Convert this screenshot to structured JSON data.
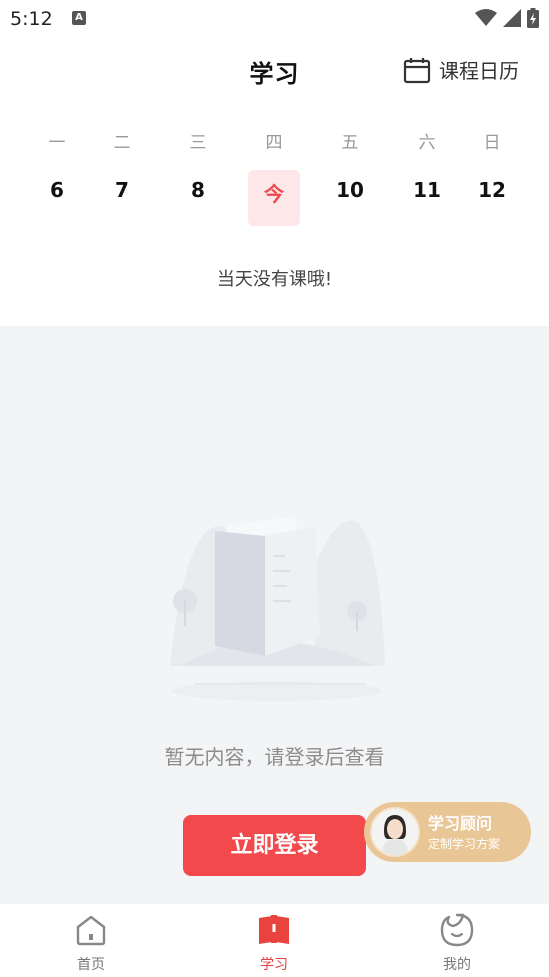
{
  "status_bar": {
    "time": "5:12",
    "notification_badge": "A"
  },
  "header": {
    "title": "学习",
    "calendar_label": "课程日历"
  },
  "week": {
    "weekdays": [
      "一",
      "二",
      "三",
      "四",
      "五",
      "六",
      "日"
    ],
    "dates": [
      "6",
      "7",
      "8",
      "今",
      "10",
      "11",
      "12"
    ],
    "selected_index": 3
  },
  "schedule": {
    "no_class_text": "当天没有课哦!"
  },
  "empty_state": {
    "message": "暂无内容，请登录后查看",
    "login_button": "立即登录"
  },
  "advisor": {
    "title": "学习顾问",
    "subtitle": "定制学习方案"
  },
  "tabbar": {
    "items": [
      {
        "label": "首页",
        "icon": "home-icon",
        "active": false
      },
      {
        "label": "学习",
        "icon": "book-icon",
        "active": true
      },
      {
        "label": "我的",
        "icon": "profile-icon",
        "active": false
      }
    ]
  },
  "colors": {
    "accent": "#f24a4c",
    "today_bg": "#fde7e8",
    "advisor_bg": "#e9c695",
    "content_bg": "#f3f4f6"
  }
}
